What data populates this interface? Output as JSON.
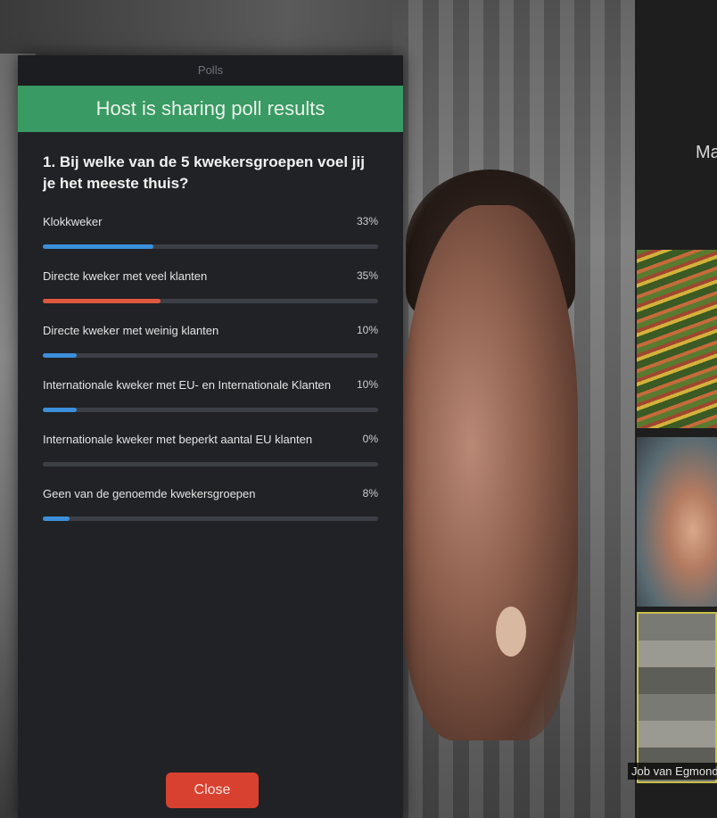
{
  "sidebar": {
    "title_partial": "Ma",
    "participant_label": "Job van Egmond"
  },
  "poll": {
    "window_title": "Polls",
    "banner": "Host is sharing poll results",
    "question": "1. Bij welke van de 5 kwekersgroepen voel jij je het meeste thuis?",
    "options": [
      {
        "label": "Klokkweker",
        "percent_label": "33%",
        "value": 0.33,
        "highlight": false
      },
      {
        "label": "Directe kweker met veel klanten",
        "percent_label": "35%",
        "value": 0.35,
        "highlight": true
      },
      {
        "label": "Directe kweker met weinig klanten",
        "percent_label": "10%",
        "value": 0.1,
        "highlight": false
      },
      {
        "label": "Internationale kweker met EU- en Internationale Klanten",
        "percent_label": "10%",
        "value": 0.1,
        "highlight": false
      },
      {
        "label": "Internationale kweker met beperkt aantal EU klanten",
        "percent_label": "0%",
        "value": 0.0,
        "highlight": false
      },
      {
        "label": "Geen van de genoemde kwekersgroepen",
        "percent_label": "8%",
        "value": 0.08,
        "highlight": false
      }
    ],
    "close_label": "Close"
  },
  "colors": {
    "banner_green": "#3a9a63",
    "bar_blue": "#3b8fdb",
    "bar_highlight": "#e0573f",
    "close_button": "#d8402f"
  }
}
